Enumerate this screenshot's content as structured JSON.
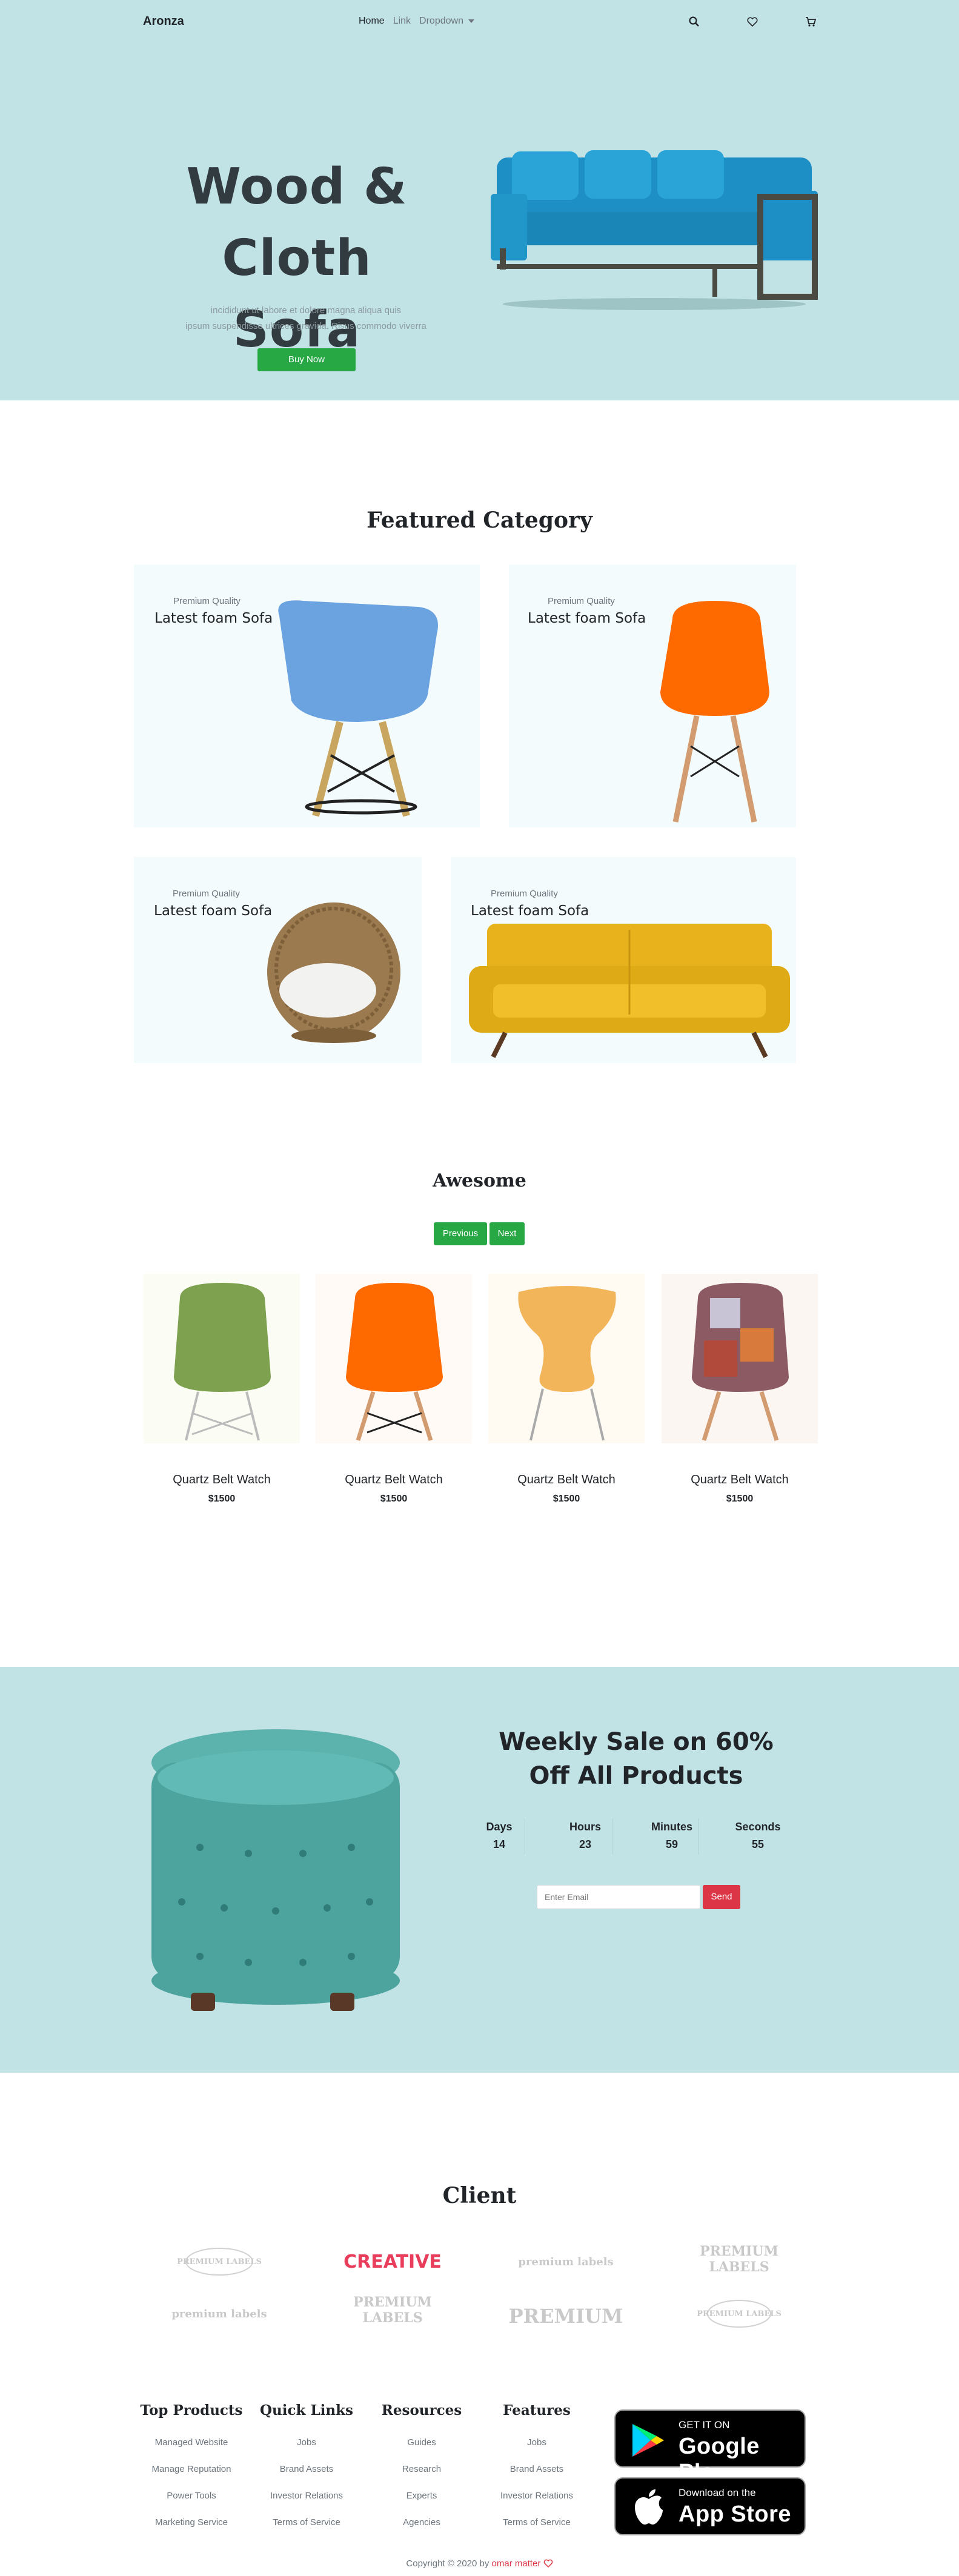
{
  "nav": {
    "brand": "Aronza",
    "links": [
      "Home",
      "Link",
      "Dropdown"
    ]
  },
  "hero": {
    "title_line1": "Wood & Cloth",
    "title_line2": "Sofa",
    "subtitle_line1": "incididunt ut labore et dolore magna aliqua quis",
    "subtitle_line2": "ipsum suspendisse ultrices gravida. Risus commodo viverra",
    "button": "Buy Now"
  },
  "featured": {
    "title": "Featured Category",
    "cards": [
      {
        "small": "Premium Quality",
        "big": "Latest foam Sofa"
      },
      {
        "small": "Premium Quality",
        "big": "Latest foam Sofa"
      },
      {
        "small": "Premium Quality",
        "big": "Latest foam Sofa"
      },
      {
        "small": "Premium Quality",
        "big": "Latest foam Sofa"
      }
    ]
  },
  "awesome": {
    "title": "Awesome",
    "prev": "Previous",
    "next": "Next",
    "products": [
      {
        "name": "Quartz Belt Watch",
        "price": "$1500"
      },
      {
        "name": "Quartz Belt Watch",
        "price": "$1500"
      },
      {
        "name": "Quartz Belt Watch",
        "price": "$1500"
      },
      {
        "name": "Quartz Belt Watch",
        "price": "$1500"
      }
    ]
  },
  "sale": {
    "title_line1": "Weekly Sale on 60%",
    "title_line2": "Off All Products",
    "countdown": [
      {
        "label": "Days",
        "value": "14"
      },
      {
        "label": "Hours",
        "value": "23"
      },
      {
        "label": "Minutes",
        "value": "59"
      },
      {
        "label": "Seconds",
        "value": "55"
      }
    ],
    "email_placeholder": "Enter Email",
    "send": "Send"
  },
  "client": {
    "title": "Client",
    "logos": [
      "PREMIUM LABELS",
      "CREATIVE",
      "premium labels",
      "PREMIUM LABELS",
      "premium labels",
      "PREMIUM LABELS",
      "PREMIUM",
      "PREMIUM LABELS"
    ]
  },
  "footer": {
    "columns": [
      {
        "heading": "Top Products",
        "items": [
          "Managed Website",
          "Manage Reputation",
          "Power Tools",
          "Marketing Service"
        ]
      },
      {
        "heading": "Quick Links",
        "items": [
          "Jobs",
          "Brand Assets",
          "Investor Relations",
          "Terms of Service"
        ]
      },
      {
        "heading": "Resources",
        "items": [
          "Guides",
          "Research",
          "Experts",
          "Agencies"
        ]
      },
      {
        "heading": "Features",
        "items": [
          "Jobs",
          "Brand Assets",
          "Investor Relations",
          "Terms of Service"
        ]
      }
    ],
    "google_top": "GET IT ON",
    "google_bottom": "Google Play",
    "apple_top": "Download on the",
    "apple_bottom": "App Store",
    "copyright_prefix": "Copyright © 2020 by",
    "copyright_author": "omar matter"
  },
  "colors": {
    "hero_bg": "#c2e3e5",
    "accent_green": "#28a745",
    "accent_red": "#dc3545",
    "card_bg": "#f4fbfd"
  }
}
